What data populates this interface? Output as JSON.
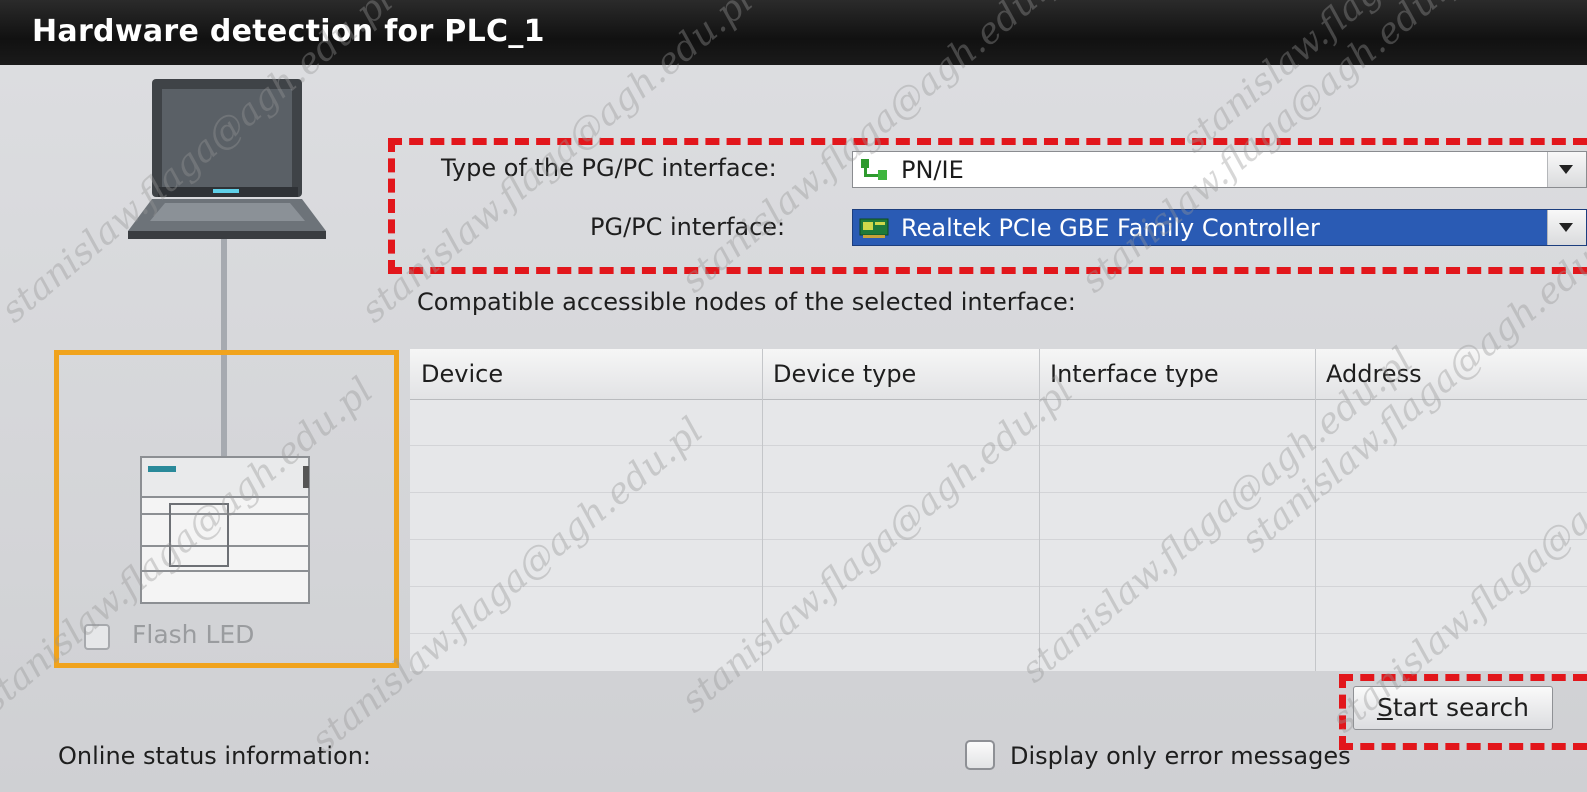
{
  "window": {
    "title": "Hardware detection for PLC_1"
  },
  "interface": {
    "type_label": "Type of the PG/PC interface:",
    "type_value": "PN/IE",
    "pgpc_label": "PG/PC interface:",
    "pgpc_value": "Realtek PCIe GBE Family Controller"
  },
  "nodes": {
    "caption": "Compatible accessible nodes of the selected interface:",
    "columns": [
      "Device",
      "Device type",
      "Interface type",
      "Address"
    ],
    "rows": []
  },
  "left": {
    "flash_led_label": "Flash LED",
    "flash_led_checked": false
  },
  "actions": {
    "start_search_label": "Start search"
  },
  "status": {
    "online_status_label": "Online status information:",
    "display_errors_label": "Display only error messages",
    "display_errors_checked": false
  },
  "watermark": "stanislaw.flaga@agh.edu.pl",
  "colors": {
    "highlight": "#e2161b",
    "node_frame": "#f0a31d",
    "selection": "#2a5bb4"
  },
  "icons": {
    "type_icon": "ethernet-network-icon",
    "pgpc_icon": "network-card-icon",
    "dropdown": "dropdown-arrow-icon"
  }
}
